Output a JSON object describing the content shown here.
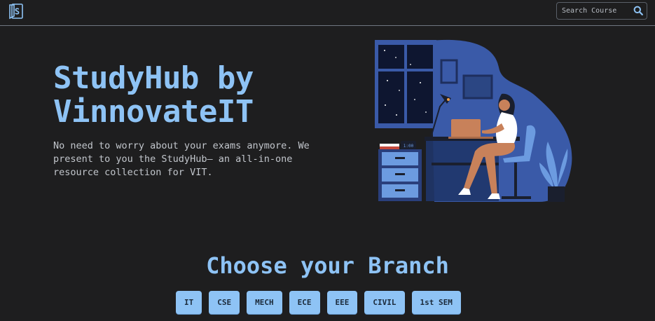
{
  "navbar": {
    "logo_icon": "book-s-logo-icon",
    "search": {
      "placeholder": "Search Course",
      "icon": "search-icon"
    }
  },
  "hero": {
    "title": "StudyHub by VinnovateIT",
    "subtitle": "No need to worry about your exams anymore. We present to you the StudyHub— an all-in-one resource collection for VIT.",
    "illustration_clock_text": "1:00"
  },
  "branches": {
    "heading": "Choose your Branch",
    "items": [
      {
        "label": "IT"
      },
      {
        "label": "CSE"
      },
      {
        "label": "MECH"
      },
      {
        "label": "ECE"
      },
      {
        "label": "EEE"
      },
      {
        "label": "CIVIL"
      },
      {
        "label": "1st SEM"
      }
    ]
  },
  "colors": {
    "background": "#1e1e1f",
    "accent": "#8ec3f5",
    "text_muted": "#c2c6cc",
    "illustration_blue": "#3a5aa8"
  }
}
